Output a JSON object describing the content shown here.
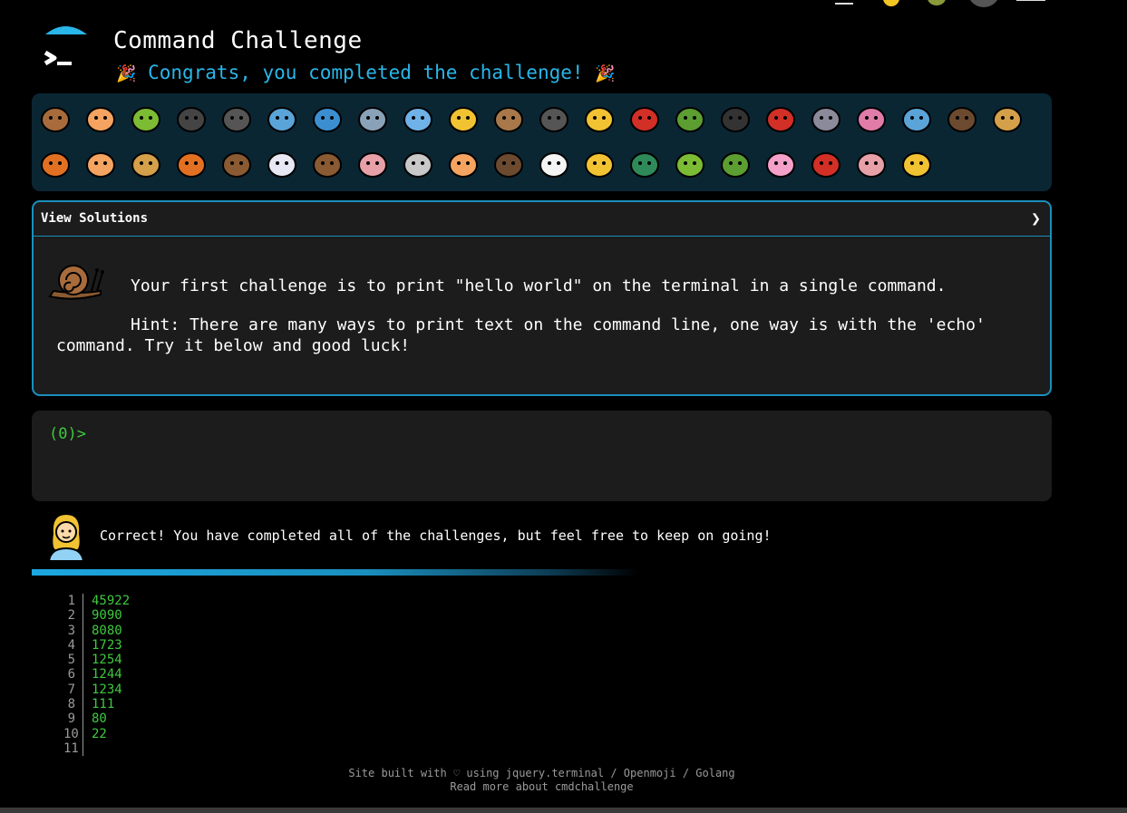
{
  "header": {
    "title": "Command Challenge",
    "subtitle": "Congrats, you completed the challenge!",
    "subtitle_icon": "party-popper-icon",
    "logo_icon": "terminal-logo-icon"
  },
  "colors": {
    "accent": "#29b6e8",
    "terminal_green": "#3ec93e",
    "badge_bar_bg": "#0b2633",
    "panel_bg": "#1c1c1c",
    "border": "#1a8fbe"
  },
  "badges": [
    "snail-icon",
    "butterfly-icon",
    "caterpillar-icon",
    "ant-icon",
    "spider-web-icon",
    "whale-icon",
    "dolphin-icon",
    "shark-icon",
    "fish-icon",
    "tropical-fish-icon",
    "blowfish-icon",
    "wolf-icon",
    "bee-icon",
    "ladybug-icon",
    "cricket-icon",
    "spider-icon",
    "scorpion-icon",
    "fly-icon",
    "worm-icon",
    "microbe-icon",
    "monkey-icon",
    "dog-icon",
    "fox-icon",
    "cat-icon",
    "lion-icon",
    "tiger-icon",
    "horse-icon",
    "unicorn-icon",
    "cow-icon",
    "pig-icon",
    "mouse-icon",
    "hamster-icon",
    "bear-icon",
    "panda-icon",
    "hatching-chick-icon",
    "peacock-icon",
    "frog-icon",
    "dragon-icon",
    "cherry-blossom-icon",
    "rose-icon",
    "hibiscus-icon",
    "sunflower-icon"
  ],
  "solutions": {
    "label": "View Solutions",
    "toggle": "❯"
  },
  "challenge": {
    "icon": "snail-icon",
    "text": "Your first challenge is to print \"hello world\" on the terminal in a single command.",
    "hint_line1": "Hint: There are many ways to print text on the command line, one way is with the 'echo'",
    "hint_line2": "command. Try it below and good luck!"
  },
  "terminal": {
    "prompt": "(0)>"
  },
  "feedback": {
    "avatar_icon": "woman-avatar-icon",
    "message": "Correct! You have completed all of the challenges, but feel free to keep on going!"
  },
  "progress": {
    "percent": 100
  },
  "output": [
    {
      "line": "1",
      "value": "45922"
    },
    {
      "line": "2",
      "value": "9090"
    },
    {
      "line": "3",
      "value": "8080"
    },
    {
      "line": "4",
      "value": "1723"
    },
    {
      "line": "5",
      "value": "1254"
    },
    {
      "line": "6",
      "value": "1244"
    },
    {
      "line": "7",
      "value": "1234"
    },
    {
      "line": "8",
      "value": "111"
    },
    {
      "line": "9",
      "value": "80"
    },
    {
      "line": "10",
      "value": "22"
    },
    {
      "line": "11",
      "value": ""
    }
  ],
  "footer": {
    "line1": "Site built with ♡ using jquery.terminal / Openmoji / Golang",
    "line2": "Read more about cmdchallenge"
  }
}
